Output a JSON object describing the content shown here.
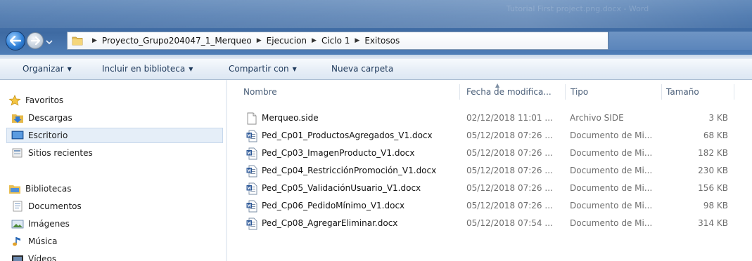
{
  "window": {
    "title": "Tutorial First project.png.docx - Word"
  },
  "address": {
    "crumbs": [
      "Proyecto_Grupo204047_1_Merqueo",
      "Ejecucion",
      "Ciclo 1",
      "Exitosos"
    ]
  },
  "commands": {
    "organize": "Organizar",
    "include_library": "Incluir en biblioteca",
    "share": "Compartir con",
    "new_folder": "Nueva carpeta"
  },
  "sidebar": {
    "favorites": "Favoritos",
    "downloads": "Descargas",
    "desktop": "Escritorio",
    "recent": "Sitios recientes",
    "libraries": "Bibliotecas",
    "documents": "Documentos",
    "images": "Imágenes",
    "music": "Música",
    "videos": "Vídeos"
  },
  "columns": {
    "name": "Nombre",
    "date": "Fecha de modifica...",
    "type": "Tipo",
    "size": "Tamaño"
  },
  "files": [
    {
      "name": "Merqueo.side",
      "date": "02/12/2018 11:01 ...",
      "type": "Archivo SIDE",
      "size": "3 KB",
      "kind": "generic"
    },
    {
      "name": "Ped_Cp01_ProductosAgregados_V1.docx",
      "date": "05/12/2018 07:26 ...",
      "type": "Documento de Mi...",
      "size": "68 KB",
      "kind": "word"
    },
    {
      "name": "Ped_Cp03_ImagenProducto_V1.docx",
      "date": "05/12/2018 07:26 ...",
      "type": "Documento de Mi...",
      "size": "182 KB",
      "kind": "word"
    },
    {
      "name": "Ped_Cp04_RestricciónPromoción_V1.docx",
      "date": "05/12/2018 07:26 ...",
      "type": "Documento de Mi...",
      "size": "230 KB",
      "kind": "word"
    },
    {
      "name": "Ped_Cp05_ValidaciónUsuario_V1.docx",
      "date": "05/12/2018 07:26 ...",
      "type": "Documento de Mi...",
      "size": "156 KB",
      "kind": "word"
    },
    {
      "name": "Ped_Cp06_PedidoMínimo_V1.docx",
      "date": "05/12/2018 07:26 ...",
      "type": "Documento de Mi...",
      "size": "98 KB",
      "kind": "word"
    },
    {
      "name": "Ped_Cp08_AgregarEliminar.docx",
      "date": "05/12/2018 07:54 ...",
      "type": "Documento de Mi...",
      "size": "314 KB",
      "kind": "word"
    }
  ]
}
